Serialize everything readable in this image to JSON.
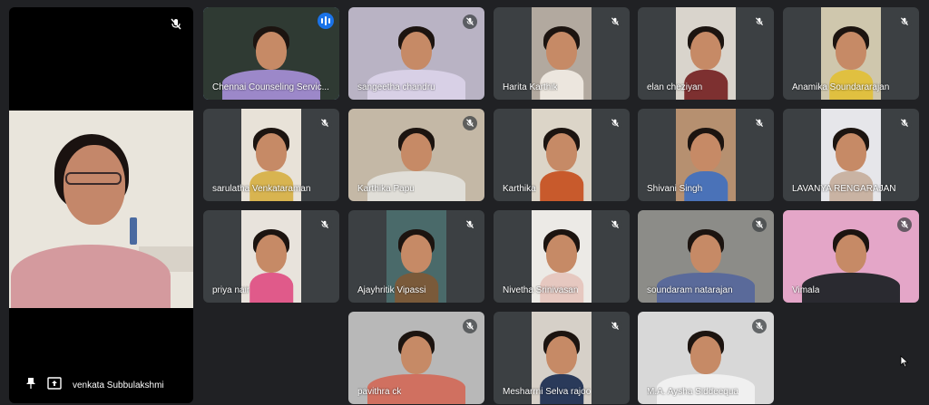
{
  "colors": {
    "background": "#202124",
    "tile": "#3c4043",
    "active_border": "#8ab4f8",
    "speaking": "#1a73e8"
  },
  "main_participant": {
    "name": "venkata Subbulakshmi",
    "icons": [
      "pin-icon",
      "present-icon",
      "mic-off-icon"
    ]
  },
  "participants": [
    {
      "name": "Chennai Counseling Servic...",
      "bg": "#2f3a33",
      "shirt": "#9c88c9",
      "speaking": true
    },
    {
      "name": "sangeetha chandru",
      "bg": "#b9b3c4",
      "shirt": "#d8d0e6",
      "speaking": false
    },
    {
      "name": "Harita Karthik",
      "bg": "#b2a99f",
      "shirt": "#ece6de",
      "speaking": false
    },
    {
      "name": "elan cheziyan",
      "bg": "#d9d4cc",
      "shirt": "#7d3030",
      "speaking": false
    },
    {
      "name": "Anamika Soundararajan",
      "bg": "#cfc7ad",
      "shirt": "#e0c040",
      "speaking": false
    },
    {
      "name": "sarulatha Venkataraman",
      "bg": "#e8e2d8",
      "shirt": "#d8b450",
      "speaking": false
    },
    {
      "name": "Karthika Papu",
      "bg": "#c4b8a6",
      "shirt": "#e0ded8",
      "speaking": false
    },
    {
      "name": "Karthika",
      "bg": "#dcd5c8",
      "shirt": "#c85a2c",
      "speaking": false
    },
    {
      "name": "Shivani Singh",
      "bg": "#b69070",
      "shirt": "#4a72b8",
      "speaking": false
    },
    {
      "name": "LAVANYA RENGARAJAN",
      "bg": "#e6e6ea",
      "shirt": "#c9b3a3",
      "speaking": false
    },
    {
      "name": "priya nair",
      "bg": "#e8e3dc",
      "shirt": "#e05a8a",
      "speaking": false
    },
    {
      "name": "Ajayhritik Vipassi",
      "bg": "#4a6a6a",
      "shirt": "#7a5a3a",
      "speaking": false
    },
    {
      "name": "Nivetha Srinivasan",
      "bg": "#eceae6",
      "shirt": "#e6c8c0",
      "speaking": false
    },
    {
      "name": "soundaram natarajan",
      "bg": "#8c8c88",
      "shirt": "#5a6a9a",
      "speaking": false
    },
    {
      "name": "Vimala",
      "bg": "#e4a6c8",
      "shirt": "#2a2a30",
      "speaking": false
    },
    {
      "name": "pavithra ck",
      "bg": "#b8b8b8",
      "shirt": "#d07060",
      "speaking": false
    },
    {
      "name": "Mesharrni Selva rajoo",
      "bg": "#d6d0c8",
      "shirt": "#2a3a5a",
      "speaking": false
    },
    {
      "name": "M.A. Aysha Siddeequa",
      "bg": "#d8d8d8",
      "shirt": "#f0f0f0",
      "speaking": false
    }
  ]
}
